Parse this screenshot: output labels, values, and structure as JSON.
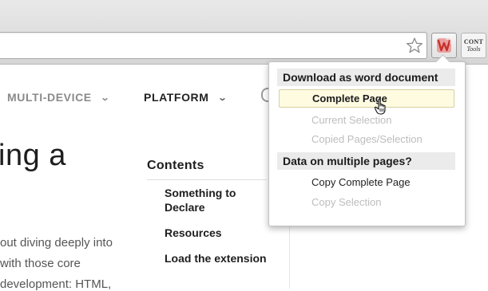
{
  "nav": {
    "multi_device": "MULTI-DEVICE",
    "platform": "PLATFORM"
  },
  "page": {
    "headline_fragment": "ing a",
    "body_lines": [
      "out diving deeply into",
      "with those core",
      "development: HTML,"
    ],
    "contents_title": "Contents",
    "toc": [
      "Something to Declare",
      "Resources",
      "Load the extension"
    ]
  },
  "extensions": {
    "tools_label_line1": "CONT",
    "tools_label_line2": "Tools"
  },
  "popup": {
    "section1_title": "Download as word document",
    "section1_items": [
      {
        "label": "Complete Page",
        "state": "hovered"
      },
      {
        "label": "Current Selection",
        "state": "disabled"
      },
      {
        "label": "Copied Pages/Selection",
        "state": "disabled"
      }
    ],
    "section2_title": "Data on multiple pages?",
    "section2_items": [
      {
        "label": "Copy Complete Page",
        "state": "enabled"
      },
      {
        "label": "Copy Selection",
        "state": "disabled"
      }
    ]
  },
  "icons": {
    "star": "star-icon",
    "word_extension": "word-extension-icon",
    "tools_extension": "tools-extension-icon",
    "cursor": "hand-cursor-icon",
    "chevron": "chevron-down-icon",
    "search": "search-icon"
  },
  "colors": {
    "hover_bg": "#fffbe1",
    "section_bg": "#ebebeb",
    "disabled_text": "#bdbdbd",
    "word_icon_red": "#c8302b"
  }
}
